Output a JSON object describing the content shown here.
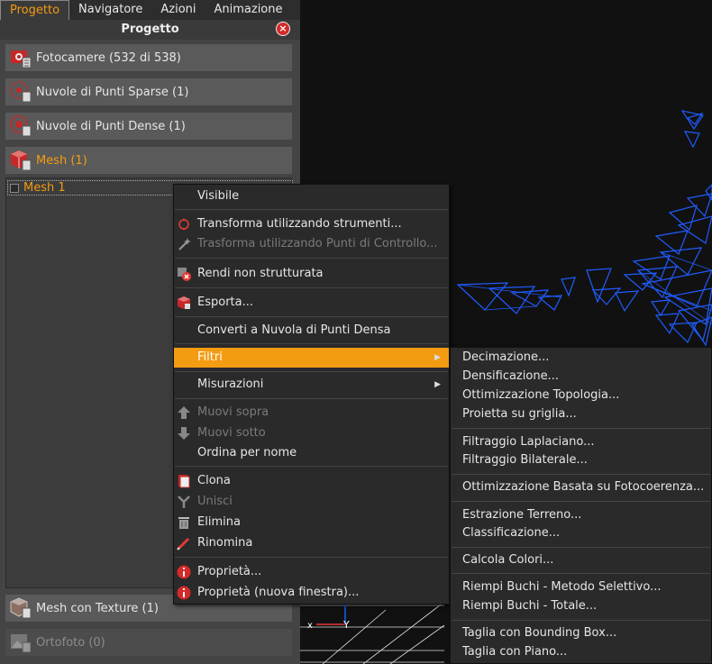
{
  "tabs": [
    "Progetto",
    "Navigatore",
    "Azioni",
    "Animazione"
  ],
  "panel_title": "Progetto",
  "sections": {
    "cameras": "Fotocamere (532 di 538)",
    "sparse": "Nuvole di Punti Sparse (1)",
    "dense": "Nuvole di Punti Dense (1)",
    "mesh": "Mesh (1)",
    "textured": "Mesh con Texture (1)",
    "ortho": "Ortofoto (0)"
  },
  "mesh_item": "Mesh 1",
  "axis_labels": {
    "x": "x",
    "y": "Y"
  },
  "context_menu": {
    "visible": "Visibile",
    "transform_tools": "Transforma utilizzando strumenti...",
    "transform_gcp": "Trasforma utilizzando Punti di Controllo...",
    "unstructured": "Rendi non strutturata",
    "export": "Esporta...",
    "convert": "Converti a Nuvola di Punti Densa",
    "filters": "Filtri",
    "measurements": "Misurazioni",
    "move_up": "Muovi sopra",
    "move_down": "Muovi sotto",
    "sort": "Ordina per nome",
    "clone": "Clona",
    "merge": "Unisci",
    "delete": "Elimina",
    "rename": "Rinomina",
    "properties": "Proprietà...",
    "properties_new": "Proprietà (nuova finestra)..."
  },
  "submenu": {
    "decimation": "Decimazione...",
    "densification": "Densificazione...",
    "topology": "Ottimizzazione Topologia...",
    "grid": "Proietta su griglia...",
    "laplacian": "Filtraggio Laplaciano...",
    "bilateral": "Filtraggio Bilaterale...",
    "photocoherence": "Ottimizzazione Basata su Fotocoerenza...",
    "terrain": "Estrazione Terreno...",
    "classification": "Classificazione...",
    "colors": "Calcola Colori...",
    "holes_selective": "Riempi Buchi - Metodo Selettivo...",
    "holes_total": "Riempi Buchi - Totale...",
    "cut_bbox": "Taglia con Bounding Box...",
    "cut_plane": "Taglia con Piano..."
  },
  "colors": {
    "accent": "#f39c12",
    "mesh_wire": "#1f5cff",
    "close": "#d42a2a"
  }
}
